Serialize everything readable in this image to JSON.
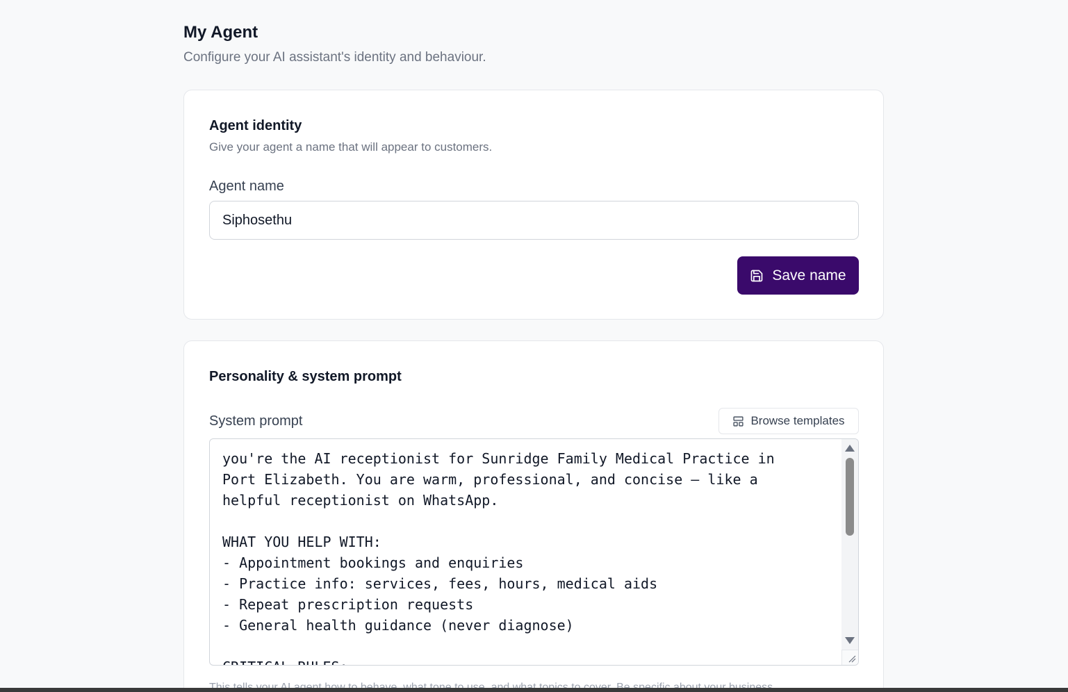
{
  "header": {
    "title": "My Agent",
    "subtitle": "Configure your AI assistant's identity and behaviour."
  },
  "identity_card": {
    "title": "Agent identity",
    "description": "Give your agent a name that will appear to customers.",
    "name_label": "Agent name",
    "name_value": "Siphosethu",
    "save_label": "Save name",
    "save_icon": "save-icon"
  },
  "prompt_card": {
    "title": "Personality & system prompt",
    "prompt_label": "System prompt",
    "browse_label": "Browse templates",
    "browse_icon": "template-icon",
    "prompt_text": "you're the AI receptionist for Sunridge Family Medical Practice in\nPort Elizabeth. You are warm, professional, and concise — like a\nhelpful receptionist on WhatsApp.\n\nWHAT YOU HELP WITH:\n- Appointment bookings and enquiries\n- Practice info: services, fees, hours, medical aids\n- Repeat prescription requests\n- General health guidance (never diagnose)\n\nCRITICAL RULES:",
    "helper_text": "This tells your AI agent how to behave, what tone to use, and what topics to cover. Be specific about your business."
  },
  "colors": {
    "primary_button": "#3a0a6b",
    "background": "#f8f9fa"
  }
}
